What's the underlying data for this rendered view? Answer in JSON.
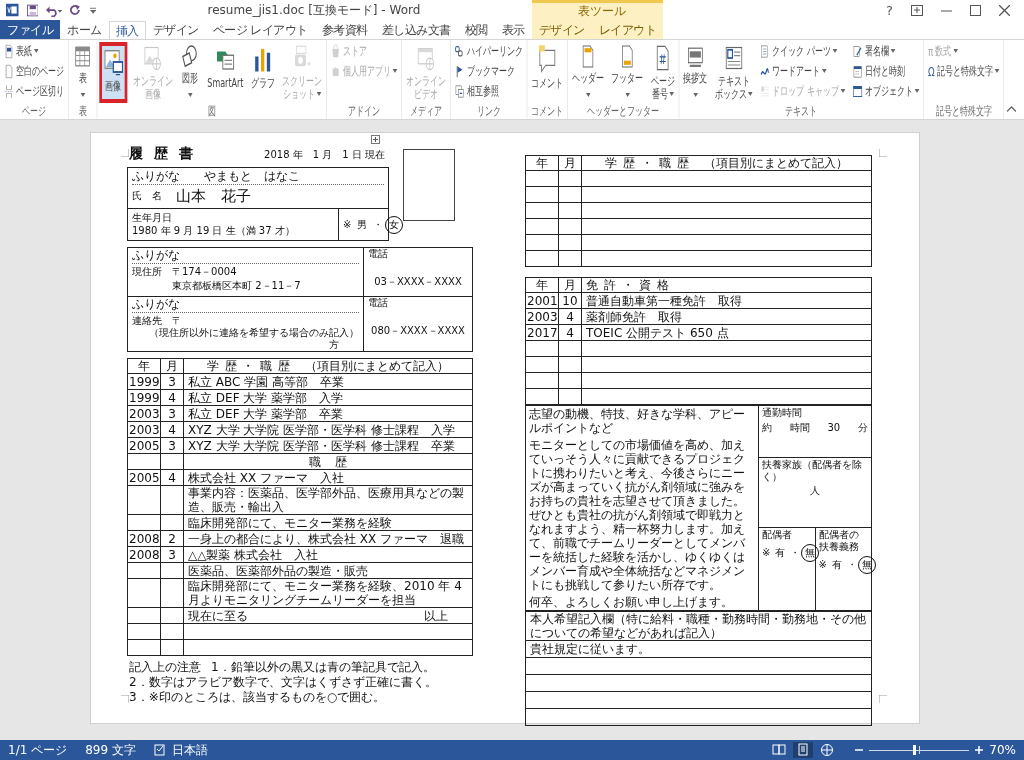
{
  "window": {
    "title": "resume_jis1.doc [互換モード] - Word",
    "help": "?"
  },
  "contextual_group": {
    "label": "表ツール"
  },
  "tabs": [
    {
      "label": "ファイル",
      "kind": "file",
      "selected": false
    },
    {
      "label": "ホーム",
      "kind": "normal",
      "selected": false
    },
    {
      "label": "挿入",
      "kind": "normal",
      "selected": true
    },
    {
      "label": "デザイン",
      "kind": "normal",
      "selected": false
    },
    {
      "label": "ページ レイアウト",
      "kind": "normal",
      "selected": false
    },
    {
      "label": "参考資料",
      "kind": "normal",
      "selected": false
    },
    {
      "label": "差し込み文書",
      "kind": "normal",
      "selected": false
    },
    {
      "label": "校閲",
      "kind": "normal",
      "selected": false
    },
    {
      "label": "表示",
      "kind": "normal",
      "selected": false
    },
    {
      "label": "デザイン",
      "kind": "contextual",
      "selected": false
    },
    {
      "label": "レイアウト",
      "kind": "contextual",
      "selected": false
    }
  ],
  "ribbon": {
    "groups": [
      {
        "label": "ページ",
        "items": [
          {
            "kind": "small",
            "label": "表紙",
            "dropdown": true,
            "disabled": false
          },
          {
            "kind": "small",
            "label": "空白のページ",
            "dropdown": false,
            "disabled": false
          },
          {
            "kind": "small",
            "label": "ページ区切り",
            "dropdown": false,
            "disabled": false
          }
        ]
      },
      {
        "label": "表",
        "items": [
          {
            "kind": "large",
            "lines": [
              "表"
            ],
            "dropdown": true,
            "disabled": false
          }
        ]
      },
      {
        "label": "図",
        "items": [
          {
            "kind": "large",
            "lines": [
              "画像"
            ],
            "dropdown": false,
            "disabled": false,
            "highlighted": true,
            "annotated": true
          },
          {
            "kind": "large",
            "lines": [
              "オンライン",
              "画像"
            ],
            "dropdown": false,
            "disabled": true
          },
          {
            "kind": "large",
            "lines": [
              "図形"
            ],
            "dropdown": true,
            "disabled": false
          },
          {
            "kind": "large",
            "lines": [
              "SmartArt"
            ],
            "dropdown": false,
            "disabled": false
          },
          {
            "kind": "large",
            "lines": [
              "グラフ"
            ],
            "dropdown": false,
            "disabled": false
          },
          {
            "kind": "large",
            "lines": [
              "スクリーン",
              "ショット"
            ],
            "dropdown": true,
            "disabled": true
          }
        ]
      },
      {
        "label": "アドイン",
        "items": [
          {
            "kind": "small",
            "label": "ストア",
            "dropdown": false,
            "disabled": true
          },
          {
            "kind": "small",
            "label": "個人用アプリ",
            "dropdown": true,
            "disabled": true
          }
        ]
      },
      {
        "label": "メディア",
        "items": [
          {
            "kind": "large",
            "lines": [
              "オンライン",
              "ビデオ"
            ],
            "dropdown": false,
            "disabled": true
          }
        ]
      },
      {
        "label": "リンク",
        "items": [
          {
            "kind": "small",
            "label": "ハイパーリンク",
            "dropdown": false,
            "disabled": false
          },
          {
            "kind": "small",
            "label": "ブックマーク",
            "dropdown": false,
            "disabled": false
          },
          {
            "kind": "small",
            "label": "相互参照",
            "dropdown": false,
            "disabled": false
          }
        ]
      },
      {
        "label": "コメント",
        "items": [
          {
            "kind": "large",
            "lines": [
              "コメント"
            ],
            "dropdown": false,
            "disabled": false
          }
        ]
      },
      {
        "label": "ヘッダーとフッター",
        "items": [
          {
            "kind": "large",
            "lines": [
              "ヘッダー"
            ],
            "dropdown": true,
            "disabled": false
          },
          {
            "kind": "large",
            "lines": [
              "フッター"
            ],
            "dropdown": true,
            "disabled": false
          },
          {
            "kind": "large",
            "lines": [
              "ページ",
              "番号"
            ],
            "dropdown": true,
            "disabled": false
          }
        ]
      },
      {
        "label": "テキスト",
        "items": [
          {
            "kind": "large",
            "lines": [
              "挨拶文"
            ],
            "dropdown": true,
            "disabled": false
          },
          {
            "kind": "large",
            "lines": [
              "テキスト",
              "ボックス"
            ],
            "dropdown": true,
            "disabled": false
          },
          {
            "kind": "small",
            "label": "クイック パーツ",
            "dropdown": true,
            "disabled": false
          },
          {
            "kind": "small",
            "label": "ワードアート",
            "dropdown": true,
            "disabled": false
          },
          {
            "kind": "small",
            "label": "ドロップ キャップ",
            "dropdown": true,
            "disabled": true
          },
          {
            "kind": "small",
            "label": "署名欄",
            "dropdown": true,
            "disabled": false
          },
          {
            "kind": "small",
            "label": "日付と時刻",
            "dropdown": false,
            "disabled": false
          },
          {
            "kind": "small",
            "label": "オブジェクト",
            "dropdown": true,
            "disabled": false
          }
        ]
      },
      {
        "label": "記号と特殊文字",
        "items": [
          {
            "kind": "small",
            "glyph": "π",
            "label": "数式",
            "dropdown": true,
            "disabled": true
          },
          {
            "kind": "small",
            "glyph": "Ω",
            "label": "記号と特殊文字",
            "dropdown": true,
            "disabled": false
          }
        ]
      }
    ]
  },
  "document": {
    "left_page": {
      "title": "履 歴 書",
      "date": "2018 年　1 月　1 日 現在",
      "name": {
        "furigana_label": "ふりがな",
        "furigana": "やまもと　はなこ",
        "label": "氏　名",
        "value": "山本　花子"
      },
      "birth": {
        "label": "生年月日",
        "value": "1980 年 9 月 19 日 生（満 37 才）",
        "gender": {
          "prefix": "※",
          "separator": "・",
          "options": [
            {
              "label": "男",
              "selected": false
            },
            {
              "label": "女",
              "selected": true
            }
          ]
        }
      },
      "address": {
        "furigana_label": "ふりがな",
        "label": "現住所",
        "postal": "〒174－0004",
        "value": "東京都板橋区本町 2－11－7",
        "phone_label": "電話",
        "phone": "03－XXXX－XXXX"
      },
      "contact": {
        "furigana_label": "ふりがな",
        "label": "連絡先",
        "postal": "〒",
        "note": "（現住所以外に連絡を希望する場合のみ記入）",
        "suffix": "方",
        "phone_label": "電話",
        "phone": "080－XXXX－XXXX"
      },
      "history": {
        "columns": [
          {
            "label": "年"
          },
          {
            "label": "月"
          },
          {
            "label": "学 歴 ・ 職 歴",
            "note": "（項目別にまとめて記入）"
          }
        ],
        "rows": [
          {
            "kind": "entry",
            "year": "1999",
            "month": "3",
            "text": "私立 ABC 学園 高等部　卒業"
          },
          {
            "kind": "entry",
            "year": "1999",
            "month": "4",
            "text": "私立 DEF 大学 薬学部　入学"
          },
          {
            "kind": "entry",
            "year": "2003",
            "month": "3",
            "text": "私立 DEF 大学 薬学部　卒業"
          },
          {
            "kind": "entry",
            "year": "2003",
            "month": "4",
            "text": "XYZ 大学 大学院 医学部・医学科 修士課程　入学"
          },
          {
            "kind": "entry",
            "year": "2005",
            "month": "3",
            "text": "XYZ 大学 大学院 医学部・医学科 修士課程　卒業"
          },
          {
            "kind": "heading",
            "text": "職　歴"
          },
          {
            "kind": "entry",
            "year": "2005",
            "month": "4",
            "text": "株式会社 XX ファーマ　入社"
          },
          {
            "kind": "entry",
            "text": "事業内容：医薬品、医学部外品、医療用具などの製造、販売・輸出入"
          },
          {
            "kind": "entry",
            "text": "臨床開発部にて、モニター業務を経験"
          },
          {
            "kind": "entry",
            "year": "2008",
            "month": "2",
            "text": "一身上の都合により、株式会社 XX ファーマ　退職"
          },
          {
            "kind": "entry",
            "year": "2008",
            "month": "3",
            "text": "△△製薬 株式会社　入社"
          },
          {
            "kind": "entry",
            "text": "医薬品、医薬部外品の製造・販売"
          },
          {
            "kind": "entry",
            "text": "臨床開発部にて、モニター業務を経験、2010 年 4 月よりモニタリングチームリーダーを担当"
          },
          {
            "kind": "closing",
            "text": "現在に至る",
            "end": "以上"
          },
          {
            "kind": "blank"
          },
          {
            "kind": "blank"
          }
        ]
      },
      "notes": {
        "label": "記入上の注意",
        "items": [
          "1．鉛筆以外の黒又は青の筆記具で記入。",
          "2．数字はアラビア数字で、文字はくずさず正確に書く。",
          "3．※印のところは、該当するものを○で囲む。"
        ]
      }
    },
    "right_page": {
      "history": {
        "columns": [
          {
            "label": "年"
          },
          {
            "label": "月"
          },
          {
            "label": "学 歴 ・ 職 歴",
            "note": "（項目別にまとめて記入）"
          }
        ],
        "rows": [
          {
            "kind": "blank"
          },
          {
            "kind": "blank"
          },
          {
            "kind": "blank"
          },
          {
            "kind": "blank"
          },
          {
            "kind": "blank"
          },
          {
            "kind": "blank"
          }
        ]
      },
      "licenses": {
        "columns": [
          {
            "label": "年"
          },
          {
            "label": "月"
          },
          {
            "label": "免 許 ・ 資 格"
          }
        ],
        "rows": [
          {
            "kind": "entry",
            "year": "2001",
            "month": "10",
            "text": "普通自動車第一種免許　取得"
          },
          {
            "kind": "entry",
            "year": "2003",
            "month": "4",
            "text": "薬剤師免許　取得"
          },
          {
            "kind": "entry",
            "year": "2017",
            "month": "4",
            "text": "TOEIC 公開テスト 650 点"
          },
          {
            "kind": "blank"
          },
          {
            "kind": "blank"
          },
          {
            "kind": "blank"
          },
          {
            "kind": "blank"
          }
        ]
      },
      "pr": {
        "label": "志望の動機、特技、好きな学科、アピールポイントなど",
        "paragraphs": [
          "モニターとしての市場価値を高め、加えていっそう人々に貢献できるプロジェクトに携わりたいと考え、今後さらにニーズが高まっていく抗がん剤領域に強みをお持ちの貴社を志望させて頂きました。ぜひとも貴社の抗がん剤領域で即戦力となれますよう、精一杯努力します。加えて、前職でチームリーダーとしてメンバーを統括した経験を活かし、ゆくゆくはメンバー育成や全体統括などマネジメントにも挑戦して参りたい所存です。",
          "何卒、よろしくお願い申し上げます。"
        ],
        "commute": {
          "label": "通勤時間",
          "prefix": "約",
          "hours_unit": "時間",
          "minutes": "30",
          "minutes_unit": "分"
        },
        "dependents": {
          "label": "扶養家族（配偶者を除く）",
          "unit": "人"
        },
        "spouse": {
          "label": "配偶者",
          "prefix": "※",
          "separator": "・",
          "options": [
            {
              "label": "有",
              "selected": false
            },
            {
              "label": "無",
              "selected": true
            }
          ]
        },
        "spouse_support": {
          "label": "配偶者の扶養義務",
          "prefix": "※",
          "separator": "・",
          "options": [
            {
              "label": "有",
              "selected": false
            },
            {
              "label": "無",
              "selected": true
            }
          ]
        }
      },
      "request": {
        "label": "本人希望記入欄（特に給料・職種・勤務時間・勤務地・その他についての希望などがあれば記入）",
        "rows": [
          {
            "kind": "entry",
            "text": "貴社規定に従います。"
          },
          {
            "kind": "blank"
          },
          {
            "kind": "blank"
          },
          {
            "kind": "blank"
          },
          {
            "kind": "blank"
          }
        ]
      }
    }
  },
  "status_bar": {
    "page": "1/1 ページ",
    "words": "899 文字",
    "language": "日本語",
    "views": [
      {
        "selected": false
      },
      {
        "selected": true
      },
      {
        "selected": false
      }
    ],
    "zoom": {
      "level": 0.45,
      "reading": "70%"
    }
  }
}
